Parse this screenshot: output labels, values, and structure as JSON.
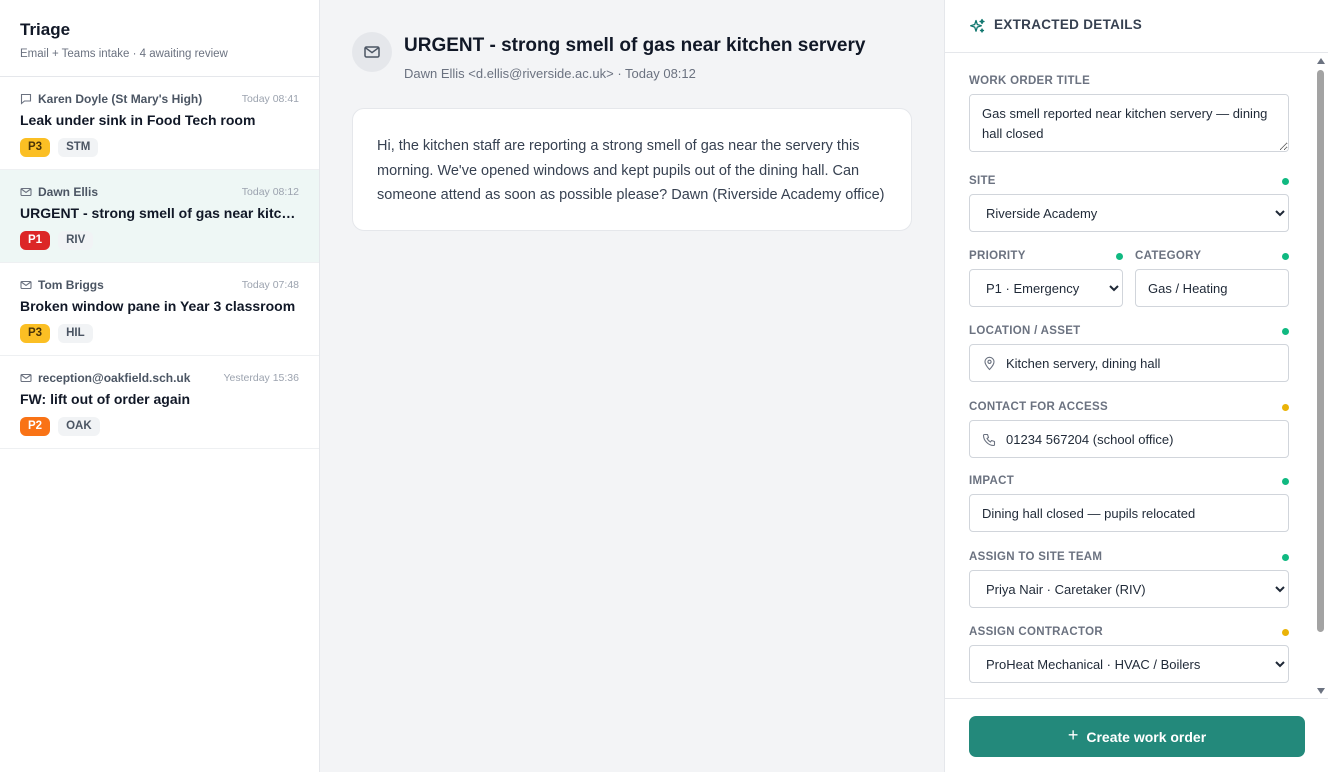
{
  "sidebar": {
    "title": "Triage",
    "subtitle": "Email + Teams intake · 4 awaiting review",
    "items": [
      {
        "sender": "Karen Doyle (St Mary's High)",
        "time": "Today 08:41",
        "subject": "Leak under sink in Food Tech room",
        "priority": "P3",
        "site": "STM",
        "channel_icon": "chat-icon"
      },
      {
        "sender": "Dawn Ellis",
        "time": "Today 08:12",
        "subject": "URGENT - strong smell of gas near kitchen servery",
        "priority": "P1",
        "site": "RIV",
        "channel_icon": "mail-icon"
      },
      {
        "sender": "Tom Briggs",
        "time": "Today 07:48",
        "subject": "Broken window pane in Year 3 classroom",
        "priority": "P3",
        "site": "HIL",
        "channel_icon": "mail-icon"
      },
      {
        "sender": "reception@oakfield.sch.uk",
        "time": "Yesterday 15:36",
        "subject": "FW: lift out of order again",
        "priority": "P2",
        "site": "OAK",
        "channel_icon": "mail-icon"
      }
    ]
  },
  "email": {
    "subject": "URGENT - strong smell of gas near kitchen servery",
    "from": "Dawn Ellis <d.ellis@riverside.ac.uk> · Today 08:12",
    "body": "Hi, the kitchen staff are reporting a strong smell of gas near the servery this morning. We've opened windows and kept pupils out of the dining hall. Can someone attend as soon as possible please? Dawn (Riverside Academy office)"
  },
  "details": {
    "header": "EXTRACTED DETAILS",
    "work_order_title_label": "WORK ORDER TITLE",
    "work_order_title": "Gas smell reported near kitchen servery — dining hall closed",
    "site_label": "SITE",
    "site_value": "Riverside Academy",
    "priority_label": "PRIORITY",
    "priority_value": "P1 · Emergency",
    "category_label": "CATEGORY",
    "category_value": "Gas / Heating",
    "location_label": "LOCATION / ASSET",
    "location_value": "Kitchen servery, dining hall",
    "contact_label": "CONTACT FOR ACCESS",
    "contact_value": "01234 567204 (school office)",
    "impact_label": "IMPACT",
    "impact_value": "Dining hall closed — pupils relocated",
    "site_team_label": "ASSIGN TO SITE TEAM",
    "site_team_value": "Priya Nair · Caretaker (RIV)",
    "contractor_label": "ASSIGN CONTRACTOR",
    "contractor_value": "ProHeat Mechanical · HVAC / Boilers",
    "create_label": "Create work order"
  },
  "colors": {
    "accent": "#23897b",
    "p1": "#dc2626",
    "p2": "#f97316",
    "p3": "#fbbf24",
    "confidence_high": "#10b981",
    "confidence_medium": "#eab308"
  }
}
